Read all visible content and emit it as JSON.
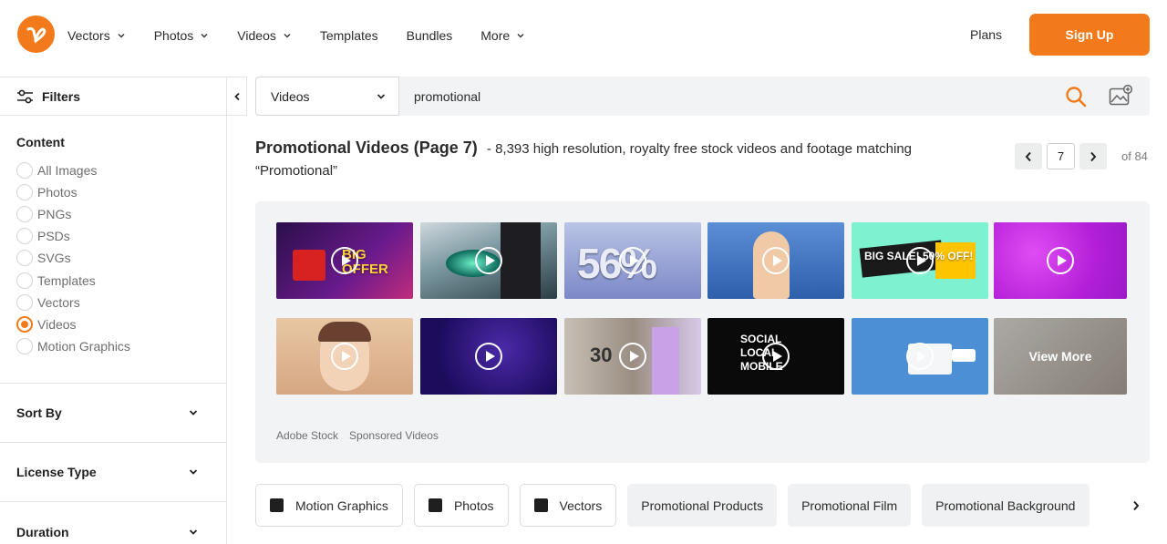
{
  "header": {
    "logo_icon": "vecteezy-logo-icon",
    "nav": [
      {
        "label": "Vectors",
        "dropdown": true
      },
      {
        "label": "Photos",
        "dropdown": true
      },
      {
        "label": "Videos",
        "dropdown": true
      },
      {
        "label": "Templates",
        "dropdown": false
      },
      {
        "label": "Bundles",
        "dropdown": false
      },
      {
        "label": "More",
        "dropdown": true
      }
    ],
    "plans": "Plans",
    "signup": "Sign Up",
    "accent": "#f27a1a"
  },
  "sidebar": {
    "filters_label": "Filters",
    "content_title": "Content",
    "content_options": [
      {
        "label": "All Images",
        "checked": false
      },
      {
        "label": "Photos",
        "checked": false
      },
      {
        "label": "PNGs",
        "checked": false
      },
      {
        "label": "PSDs",
        "checked": false
      },
      {
        "label": "SVGs",
        "checked": false
      },
      {
        "label": "Templates",
        "checked": false
      },
      {
        "label": "Vectors",
        "checked": false
      },
      {
        "label": "Videos",
        "checked": true
      },
      {
        "label": "Motion Graphics",
        "checked": false
      }
    ],
    "sort_by": "Sort By",
    "license_type": "License Type",
    "duration": "Duration"
  },
  "search": {
    "type": "Videos",
    "query": "promotional"
  },
  "results": {
    "title": "Promotional Videos (Page 7)",
    "subtitle": "- 8,393 high resolution, royalty free stock videos and footage matching",
    "query_quoted": "“Promotional”",
    "page": "7",
    "of_pages": "of 84"
  },
  "sponsored": {
    "thumb_texts": [
      "BIG OFFER",
      "",
      "56%",
      "",
      "BIG SALE! 50% OFF!",
      "",
      "",
      "",
      "30",
      "SOCIAL LOCAL MOBILE",
      "",
      ""
    ],
    "view_more": "View More",
    "source": "Adobe Stock",
    "label": "Sponsored Videos"
  },
  "chips": [
    {
      "label": "Motion Graphics",
      "style": "outline",
      "icon": "film-icon"
    },
    {
      "label": "Photos",
      "style": "outline",
      "icon": "photo-icon"
    },
    {
      "label": "Vectors",
      "style": "outline",
      "icon": "vector-icon"
    },
    {
      "label": "Promotional Products",
      "style": "fill"
    },
    {
      "label": "Promotional Film",
      "style": "fill"
    },
    {
      "label": "Promotional Background",
      "style": "fill"
    }
  ]
}
